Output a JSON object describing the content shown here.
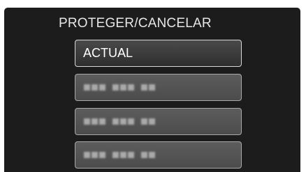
{
  "screen": {
    "title": "PROTEGER/CANCELAR"
  },
  "menu": {
    "items": [
      {
        "label": "ACTUAL",
        "selected": true
      },
      {
        "label": "",
        "selected": false
      },
      {
        "label": "",
        "selected": false
      },
      {
        "label": "",
        "selected": false
      }
    ]
  },
  "colors": {
    "panel_bg": "#1c1c1c",
    "item_border_selected": "#d8d8d8",
    "item_bg_option": "#555555"
  }
}
